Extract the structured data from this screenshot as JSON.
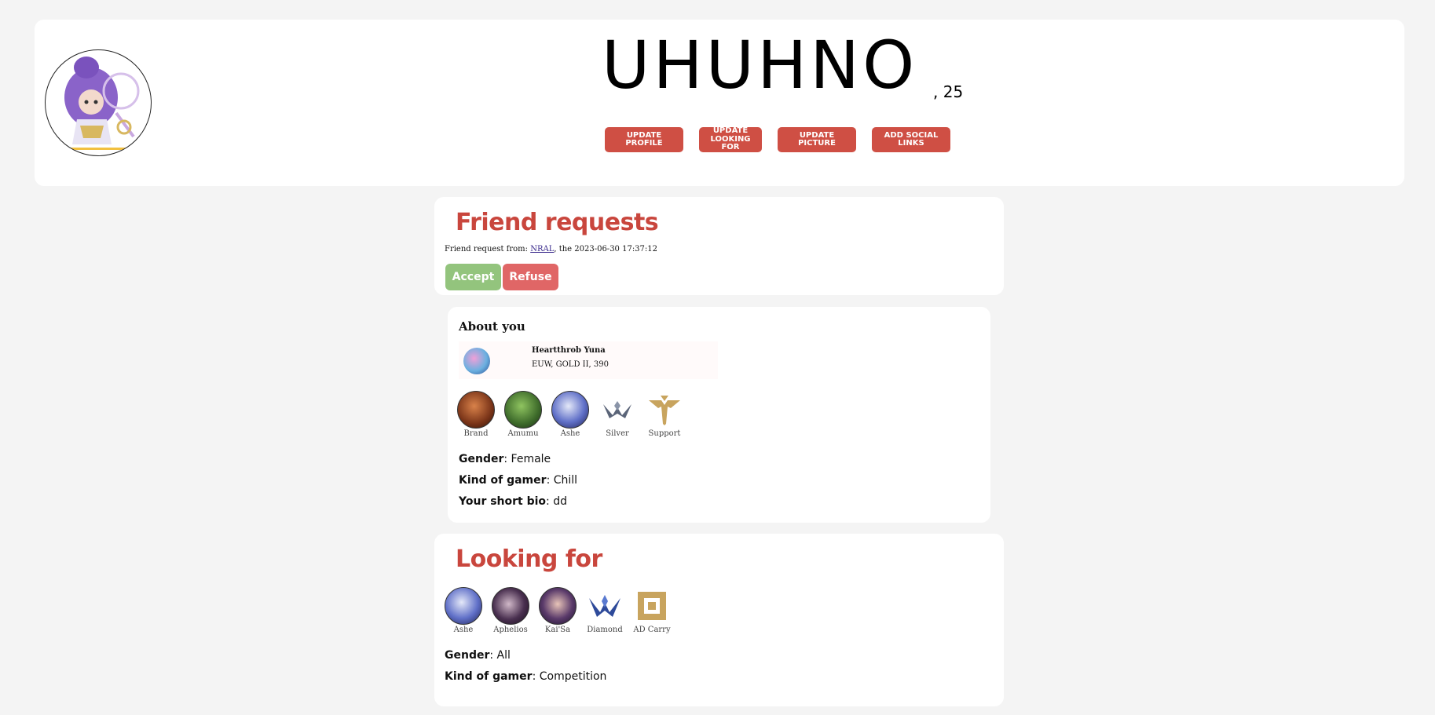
{
  "header": {
    "username": "UHUHNO",
    "age": ", 25",
    "buttons": {
      "update_profile": "UPDATE PROFILE",
      "update_looking_for": "UPDATE LOOKING FOR",
      "update_picture": "UPDATE PICTURE",
      "add_social_links": "ADD SOCIAL LINKS"
    },
    "button_color": "#cf4f44"
  },
  "friend_requests": {
    "title": "Friend requests",
    "request_prefix": "Friend request from: ",
    "request_user": "NRAL",
    "request_suffix": ", the 2023-06-30 17:37:12",
    "accept_label": "Accept",
    "refuse_label": "Refuse",
    "accept_color": "#93c47d",
    "refuse_color": "#e06666"
  },
  "about": {
    "title": "About you",
    "summoner_name": "Heartthrob Yuna",
    "summoner_info": "EUW, GOLD II, 390",
    "tokens": [
      {
        "label": "Brand",
        "icon": "brand-champion-icon"
      },
      {
        "label": "Amumu",
        "icon": "amumu-champion-icon"
      },
      {
        "label": "Ashe",
        "icon": "ashe-champion-icon"
      },
      {
        "label": "Silver",
        "icon": "silver-rank-icon"
      },
      {
        "label": "Support",
        "icon": "support-role-icon"
      }
    ],
    "gender_label": "Gender",
    "gender_value": ": Female",
    "gamer_label": "Kind of gamer",
    "gamer_value": ": Chill",
    "bio_label": "Your short bio",
    "bio_value": ": dd"
  },
  "looking_for": {
    "title": "Looking for",
    "tokens": [
      {
        "label": "Ashe",
        "icon": "ashe-champion-icon"
      },
      {
        "label": "Aphelios",
        "icon": "aphelios-champion-icon"
      },
      {
        "label": "Kai'Sa",
        "icon": "kaisa-champion-icon"
      },
      {
        "label": "Diamond",
        "icon": "diamond-rank-icon"
      },
      {
        "label": "AD Carry",
        "icon": "adcarry-role-icon"
      }
    ],
    "gender_label": "Gender",
    "gender_value": ": All",
    "gamer_label": "Kind of gamer",
    "gamer_value": ": Competition"
  },
  "accent_color": "#c9463d"
}
